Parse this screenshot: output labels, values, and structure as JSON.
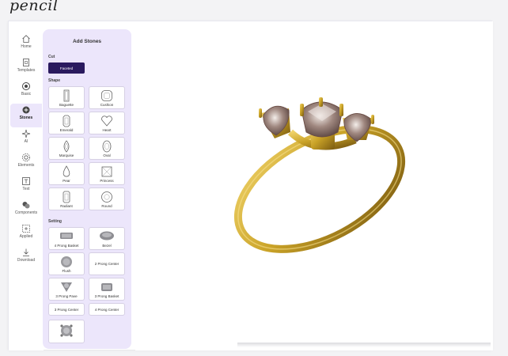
{
  "app": {
    "logo_text": "pencil"
  },
  "sidebar": {
    "items": [
      {
        "label": "Home",
        "icon": "home-icon"
      },
      {
        "label": "Templates",
        "icon": "templates-icon"
      },
      {
        "label": "Basic",
        "icon": "basic-icon"
      },
      {
        "label": "Stones",
        "icon": "stones-icon",
        "active": true
      },
      {
        "label": "AI",
        "icon": "sparkle-icon"
      },
      {
        "label": "Elements",
        "icon": "elements-icon"
      },
      {
        "label": "Text",
        "icon": "text-icon"
      },
      {
        "label": "Components",
        "icon": "components-icon"
      },
      {
        "label": "Applied",
        "icon": "applied-icon"
      },
      {
        "label": "Download",
        "icon": "download-icon"
      }
    ]
  },
  "panel": {
    "title": "Add Stones",
    "cut_label": "Cut",
    "cut_selected": "Faceted",
    "shape_label": "Shape",
    "shapes": [
      {
        "label": "Baguette",
        "icon": "baguette-shape-icon"
      },
      {
        "label": "Cushion",
        "icon": "cushion-shape-icon"
      },
      {
        "label": "Emerald",
        "icon": "emerald-shape-icon"
      },
      {
        "label": "Heart",
        "icon": "heart-shape-icon"
      },
      {
        "label": "Marquise",
        "icon": "marquise-shape-icon"
      },
      {
        "label": "Oval",
        "icon": "oval-shape-icon"
      },
      {
        "label": "Pear",
        "icon": "pear-shape-icon"
      },
      {
        "label": "Princess",
        "icon": "princess-shape-icon"
      },
      {
        "label": "Radiant",
        "icon": "radiant-shape-icon"
      },
      {
        "label": "Round",
        "icon": "round-shape-icon"
      }
    ],
    "setting_label": "Setting",
    "settings": [
      {
        "label": "4 Prong Basket",
        "icon": "4-prong-basket-icon"
      },
      {
        "label": "Bezel",
        "icon": "bezel-icon"
      },
      {
        "label": "Flush",
        "icon": "flush-icon"
      },
      {
        "label": "2 Prong Center",
        "icon": "2-prong-center-icon"
      },
      {
        "label": "3 Prong Pave",
        "icon": "3-prong-pave-icon"
      },
      {
        "label": "3 Prong Basket",
        "icon": "3-prong-basket-icon"
      },
      {
        "label": "3 Prong Center",
        "icon": "3-prong-center-icon"
      },
      {
        "label": "4 Prong Center",
        "icon": "4-prong-center-icon"
      }
    ]
  },
  "viewer": {
    "object": "gold-ring-three-stone-model",
    "metal_color": "#c9a227",
    "stone_color": "#8a6a62"
  }
}
